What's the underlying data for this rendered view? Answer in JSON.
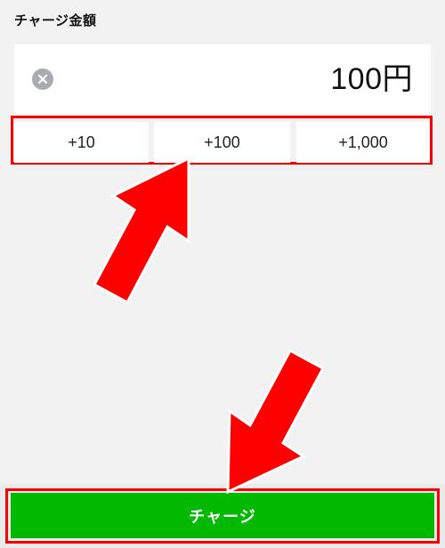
{
  "charge_amount": {
    "label": "チャージ金額",
    "value": "100円",
    "clear_icon": "clear-x-circle-icon"
  },
  "increments": [
    {
      "label": "+10"
    },
    {
      "label": "+100"
    },
    {
      "label": "+1,000"
    }
  ],
  "charge_button": {
    "label": "チャージ"
  },
  "colors": {
    "background": "#f2f2f2",
    "field_background": "#ffffff",
    "accent_green": "#00b900",
    "annotation_red": "#ff0000",
    "clear_icon_gray": "#a8abb1"
  },
  "annotations": {
    "arrow_icons": [
      "red-arrow-up-icon",
      "red-arrow-down-icon"
    ]
  }
}
